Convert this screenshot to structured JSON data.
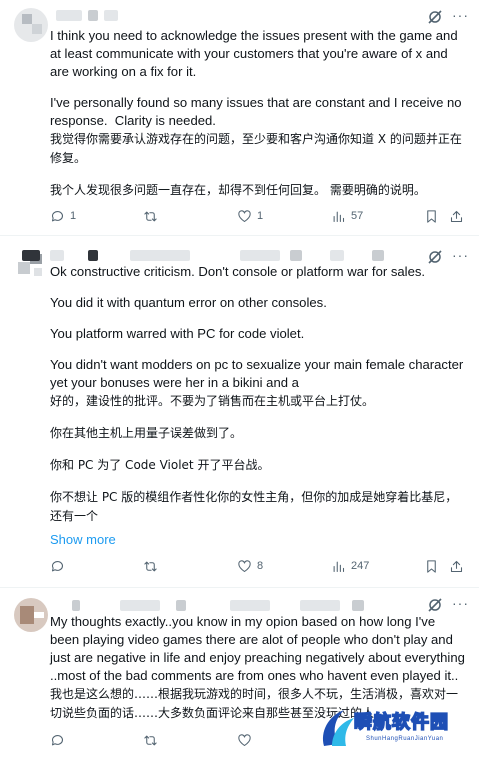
{
  "posts": [
    {
      "paragraphs_en": [
        "I think you need to acknowledge the issues present with the game and at least communicate with your customers that you're aware of x and are working on a fix for it.",
        "I've personally found so many issues that are constant and I receive no response.  Clarity is needed."
      ],
      "paragraphs_zh": [
        "我觉得你需要承认游戏存在的问题，至少要和客户沟通你知道 X 的问题并正在修复。",
        "我个人发现很多问题一直存在，却得不到任何回复。 需要明确的说明。"
      ],
      "actions": {
        "reply_count": "1",
        "repost_count": "",
        "like_count": "1",
        "views_count": "57"
      }
    },
    {
      "paragraphs_en": [
        "Ok constructive criticism. Don't console or platform war for sales.",
        "You did it with quantum error on other consoles.",
        "You platform warred with PC for code violet.",
        "You didn't want modders on pc to sexualize your main female character yet your bonuses were her in a bikini and a"
      ],
      "paragraphs_zh": [
        "好的，建设性的批评。不要为了销售而在主机或平台上打仗。",
        "你在其他主机上用量子误差做到了。",
        "你和 PC 为了 Code Violet 开了平台战。",
        "你不想让 PC 版的模组作者性化你的女性主角，但你的加成是她穿着比基尼，还有一个"
      ],
      "show_more": "Show more",
      "actions": {
        "reply_count": "",
        "repost_count": "",
        "like_count": "8",
        "views_count": "247"
      }
    },
    {
      "paragraphs_en": [
        "My thoughts exactly..you know in my opion based on how long I've been playing video games there are alot of people who don't play and just are negative in life and enjoy preaching negatively about everything ..most of the bad comments are from ones who havent even played it.."
      ],
      "paragraphs_zh": [
        "我也是这么想的……根据我玩游戏的时间，很多人不玩，生活消极，喜欢对一切说些负面的话……大多数负面评论来自那些甚至没玩过的人"
      ],
      "actions": {
        "reply_count": "",
        "repost_count": "",
        "like_count": "",
        "views_count": ""
      }
    }
  ],
  "watermark": {
    "title": "瞬航软件园",
    "subtitle": "ShunHangRuanJianYuan"
  },
  "icons": [
    "grok-icon",
    "more-icon",
    "reply-icon",
    "repost-icon",
    "like-icon",
    "views-icon",
    "bookmark-icon",
    "share-icon"
  ],
  "colors": {
    "text": "#0f1419",
    "secondary": "#536471",
    "link": "#1d9bf0",
    "divider": "#eff3f4"
  }
}
